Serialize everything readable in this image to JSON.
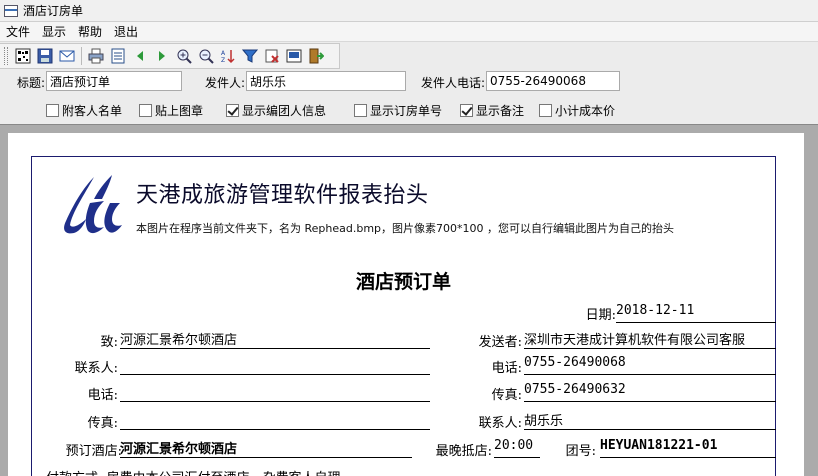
{
  "window": {
    "title": "酒店订房单"
  },
  "menu": {
    "items": [
      "文件",
      "显示",
      "帮助",
      "退出"
    ]
  },
  "toolbar": {
    "icons": [
      "barcode-icon",
      "save-icon",
      "email-icon",
      "print-icon",
      "page-setup-icon",
      "prev-page-icon",
      "next-page-icon",
      "zoom-in-icon",
      "zoom-out-icon",
      "sort-icon",
      "filter-icon",
      "clear-filter-icon",
      "export-icon",
      "exit-icon"
    ]
  },
  "fields": {
    "title_label": "标题:",
    "title_value": "酒店预订单",
    "sender_label": "发件人:",
    "sender_value": "胡乐乐",
    "phone_label": "发件人电话:",
    "phone_value": "0755-26490068"
  },
  "options": [
    {
      "label": "附客人名单",
      "checked": false
    },
    {
      "label": "贴上图章",
      "checked": false
    },
    {
      "label": "显示编团人信息",
      "checked": true
    },
    {
      "label": "显示订房单号",
      "checked": false
    },
    {
      "label": "显示备注",
      "checked": true
    },
    {
      "label": "小计成本价",
      "checked": false
    }
  ],
  "report": {
    "header_title": "天港成旅游管理软件报表抬头",
    "header_sub": "本图片在程序当前文件夹下，名为 Rephead.bmp，图片像素700*100 ，您可以自行编辑此图片为自己的抬头",
    "doc_title": "酒店预订单",
    "date_label": "日期:",
    "date_value": "2018-12-11",
    "to_label": "致:",
    "to_value": "河源汇景希尔顿酒店",
    "from_label": "发送者:",
    "from_value": "深圳市天港成计算机软件有限公司客服",
    "contact_label": "联系人:",
    "contact_value": "",
    "phone_label": "电话:",
    "phone_value": "0755-26490068",
    "left_phone_label": "电话:",
    "left_phone_value": "",
    "fax_label_r": "传真:",
    "fax_value_r": "0755-26490632",
    "fax_label": "传真:",
    "fax_value": "",
    "contact2_label": "联系人:",
    "contact2_value": "胡乐乐",
    "hotel_label": "预订酒店:",
    "hotel_value": "河源汇景希尔顿酒店",
    "arrive_label": "最晚抵店:",
    "arrive_value": "20:00",
    "group_label": "团号:",
    "group_value": "HEYUAN181221-01",
    "payment_partial": "付款方式: 房费由本公司汇付至酒店，杂费客人自理"
  }
}
